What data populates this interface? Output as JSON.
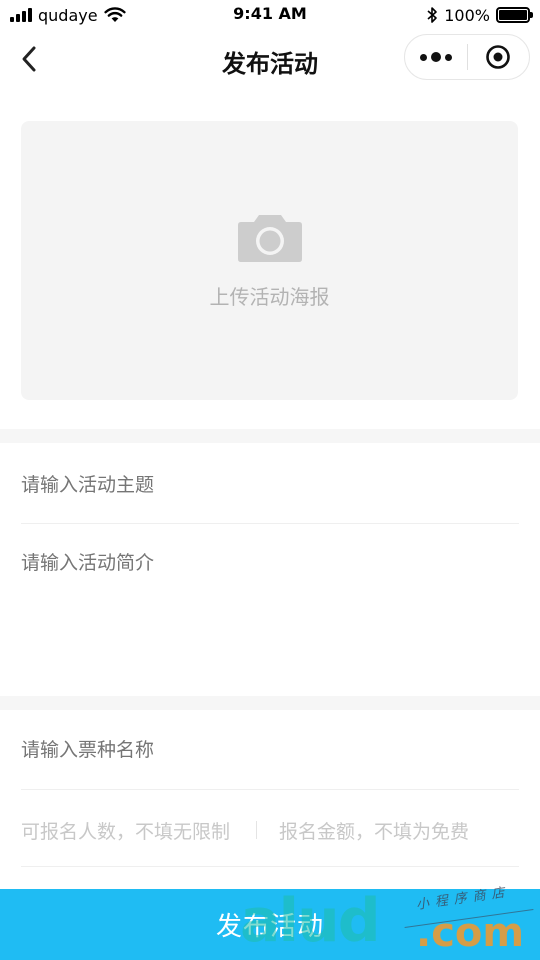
{
  "status_bar": {
    "carrier": "qudaye",
    "time": "9:41 AM",
    "battery": "100%",
    "battery_level": 1.0
  },
  "nav": {
    "title": "发布活动"
  },
  "poster": {
    "upload_label": "上传活动海报"
  },
  "form": {
    "theme_placeholder": "请输入活动主题",
    "intro_placeholder": "请输入活动简介",
    "ticket_name_placeholder": "请输入票种名称",
    "capacity_placeholder": "可报名人数，不填无限制",
    "fee_placeholder": "报名金额，不填为免费"
  },
  "submit": {
    "label": "发布活动"
  },
  "watermark": {
    "brand": "alud",
    "suffix": ".com",
    "tagline": "小程序商店"
  },
  "colors": {
    "primary": "#1fbcf3",
    "placeholder": "#c8c8c8",
    "poster_bg": "#f4f4f4"
  }
}
